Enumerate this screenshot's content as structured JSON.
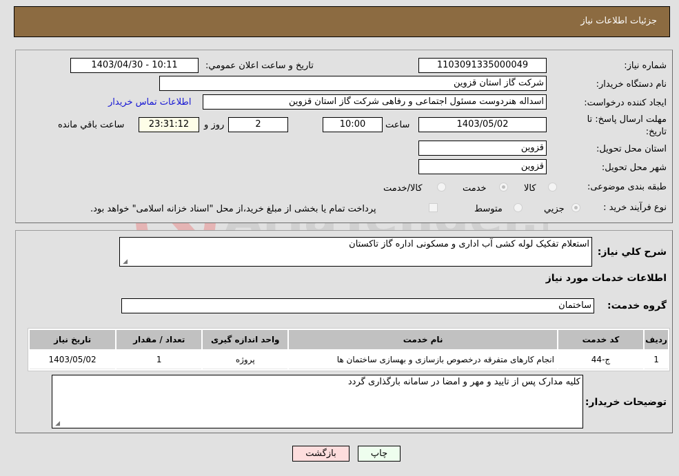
{
  "header": {
    "title": "جزئيات اطلاعات نياز"
  },
  "form": {
    "need_number": {
      "label": "شماره نیاز:",
      "value": "1103091335000049"
    },
    "announce_datetime": {
      "label": "تاريخ و ساعت اعلان عمومي:",
      "value": "1403/04/30 - 10:11"
    },
    "buyer_org": {
      "label": "نام دستگاه خریدار:",
      "value": "شرکت گاز استان قزوین"
    },
    "requester": {
      "label": "ایجاد کننده درخواست:",
      "value": "اسداله هنردوست مسئول اجتماعی و رفاهی شرکت گاز استان قزوین",
      "contact_link": "اطلاعات تماس خریدار"
    },
    "deadline": {
      "label": "مهلت ارسال پاسخ: تا تاریخ:",
      "date": "1403/05/02",
      "time_label": "ساعت",
      "time": "10:00",
      "days": "2",
      "days_label": "روز و",
      "remaining": "23:31:12",
      "remaining_label": "ساعت باقي مانده"
    },
    "province": {
      "label": "استان محل تحویل:",
      "value": "قزوین"
    },
    "city": {
      "label": "شهر محل تحویل:",
      "value": "قزوین"
    },
    "category": {
      "label": "طبقه بندی موضوعی:",
      "options": [
        "کالا",
        "خدمت",
        "کالا/خدمت"
      ],
      "selected": "خدمت"
    },
    "purchase_type": {
      "label": "نوع فرآیند خرید :",
      "options": [
        "جزيي",
        "متوسط"
      ],
      "selected": "جزيي",
      "treasury_note": "پرداخت تمام یا بخشی از مبلغ خرید،از محل \"اسناد خزانه اسلامی\" خواهد بود."
    }
  },
  "description": {
    "label": "شرح كلي نياز:",
    "value": "استعلام تفکیک لوله کشی آب اداری و مسکونی اداره گاز تاکستان"
  },
  "services": {
    "section_title": "اطلاعات خدمات مورد نياز",
    "group_label": "گروه خدمت:",
    "group_value": "ساختمان",
    "table": {
      "headers": [
        "رديف",
        "کد خدمت",
        "نام خدمت",
        "واحد اندازه گیری",
        "تعداد / مقدار",
        "تاريخ نياز"
      ],
      "rows": [
        [
          "1",
          "ج-44",
          "انجام کارهای متفرقه درخصوص بازسازی و بهسازی ساختمان ها",
          "پروژه",
          "1",
          "1403/05/02"
        ]
      ]
    }
  },
  "buyer_notes": {
    "label": "توضيحات خريدار:",
    "value": "کلیه مدارک پس از تایید و مهر و امضا در سامانه بارگذاری گردد"
  },
  "buttons": {
    "print": "چاپ",
    "back": "بازگشت"
  },
  "watermark": {
    "text": "AriaTender.neT"
  }
}
